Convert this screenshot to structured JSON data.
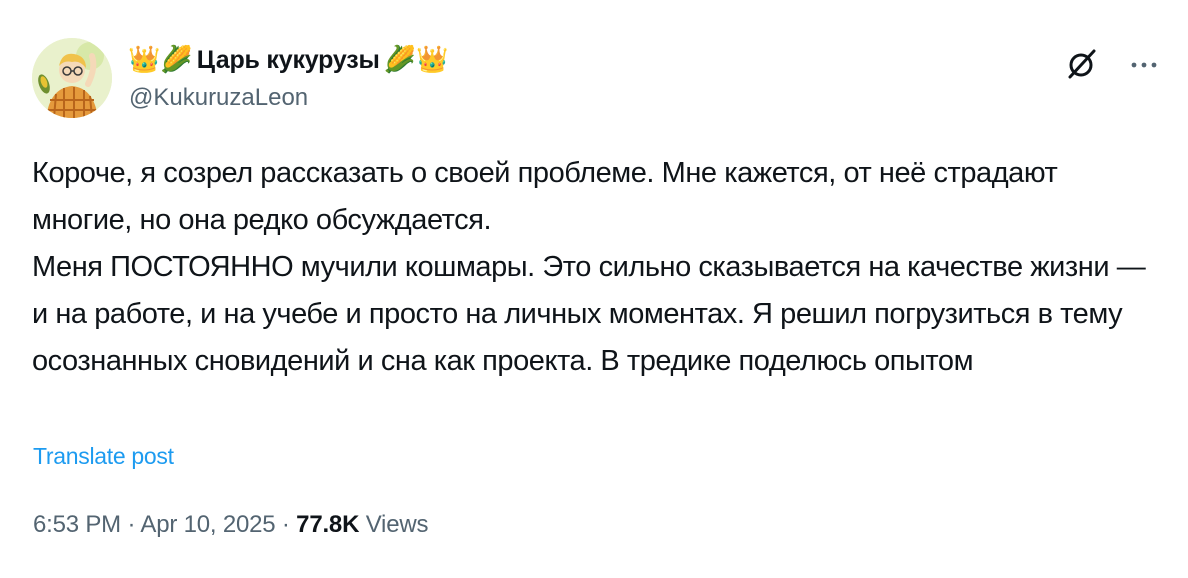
{
  "author": {
    "name_prefix_emojis": "👑🌽",
    "display_name": "Царь кукурузы",
    "name_suffix_emojis": "🌽👑",
    "handle": "@KukuruzaLeon"
  },
  "icons": {
    "avatar": "avatar",
    "grok": "grok-icon",
    "more": "more-icon"
  },
  "tweet": {
    "paragraph_1": "Короче, я созрел рассказать о своей проблеме. Мне кажется, от неё страдают многие, но она редко обсуждается.",
    "paragraph_2": "Меня ПОСТОЯННО мучили кошмары. Это сильно сказывается на качестве жизни — и на работе, и на учебе и просто на личных моментах. Я решил погрузиться в тему осознанных сновидений и сна как проекта. В тредике поделюсь опытом"
  },
  "translate_label": "Translate post",
  "meta": {
    "time": "6:53 PM",
    "separator": " · ",
    "date": "Apr 10, 2025",
    "views_count": "77.8K",
    "views_label": "Views"
  },
  "colors": {
    "text": "#0f1419",
    "secondary": "#536471",
    "link": "#1d9bf0",
    "background": "#ffffff"
  }
}
